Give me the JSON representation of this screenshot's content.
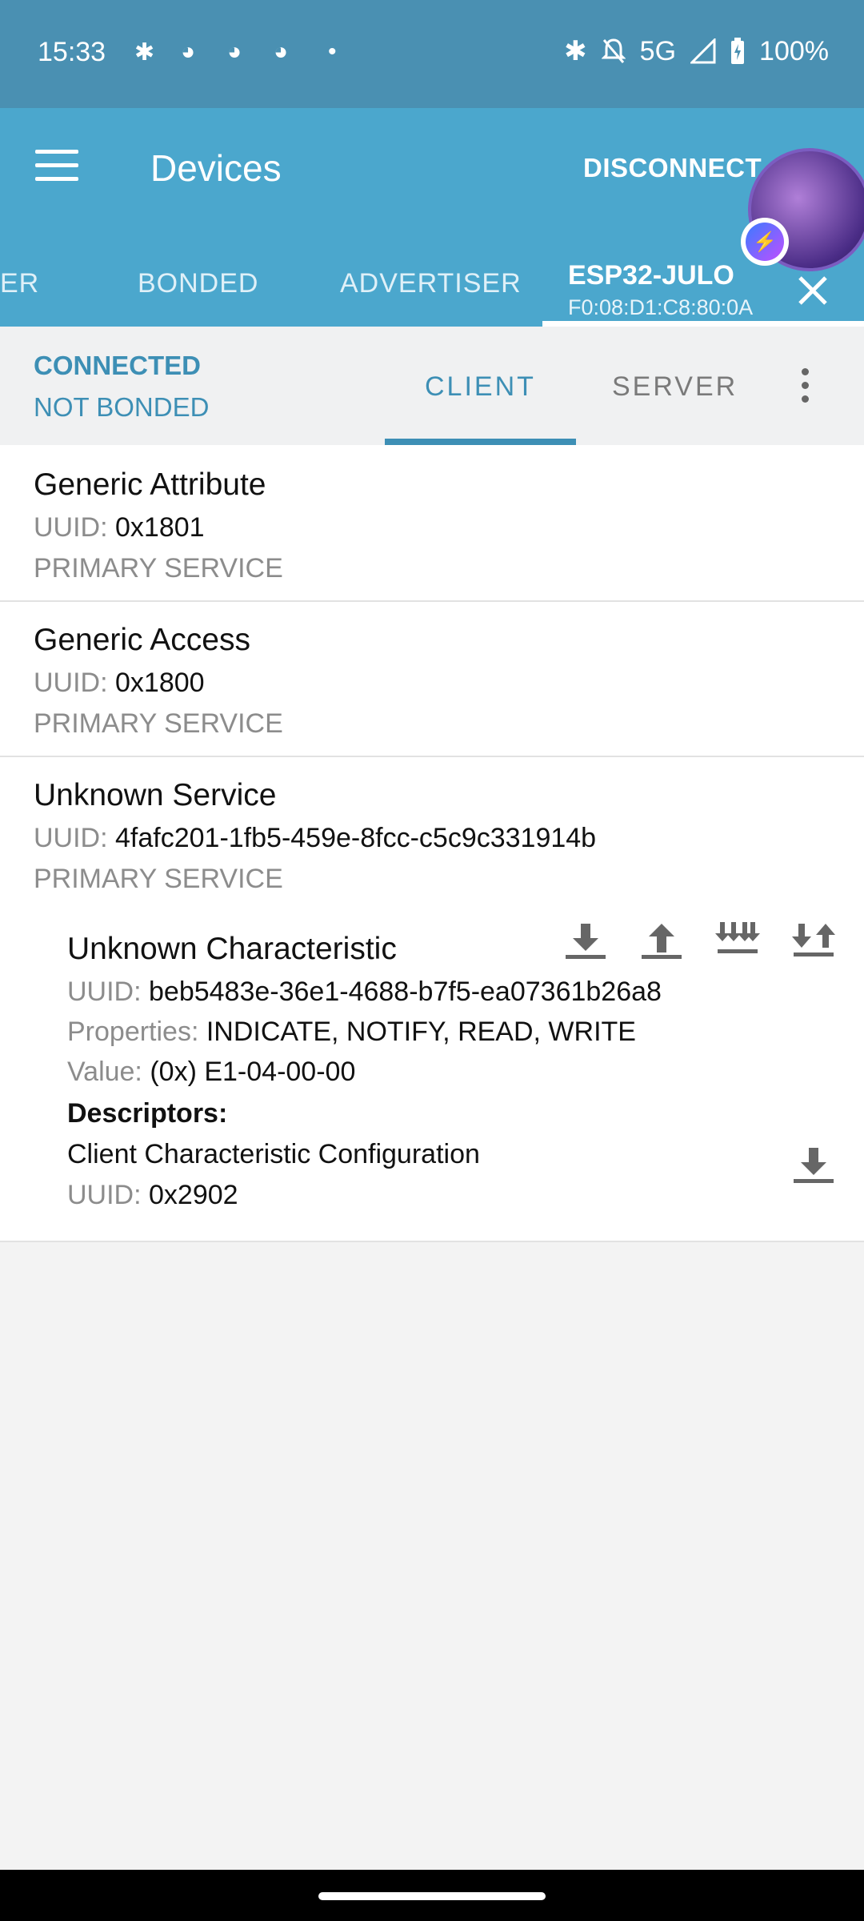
{
  "status_bar": {
    "time": "15:33",
    "network": "5G",
    "battery": "100%",
    "notification_icons": [
      "slack-icon",
      "discord-icon",
      "discord-icon",
      "discord-icon",
      "dot-icon"
    ],
    "system_icons": [
      "bluetooth-icon",
      "bell-off-icon",
      "signal-icon",
      "battery-charging-icon"
    ]
  },
  "app_bar": {
    "title": "Devices",
    "disconnect_label": "DISCONNECT",
    "tabs": [
      {
        "label": "ER"
      },
      {
        "label": "BONDED"
      },
      {
        "label": "ADVERTISER"
      }
    ],
    "active_tab": {
      "name": "ESP32-JULO",
      "mac": "F0:08:D1:C8:80:0A"
    }
  },
  "connection": {
    "status": "CONNECTED",
    "bond": "NOT BONDED",
    "client_tab": "CLIENT",
    "server_tab": "SERVER"
  },
  "labels": {
    "uuid": "UUID:",
    "properties": "Properties:",
    "value": "Value:",
    "descriptors": "Descriptors:"
  },
  "services": [
    {
      "name": "Generic Attribute",
      "uuid": "0x1801",
      "type": "PRIMARY SERVICE"
    },
    {
      "name": "Generic Access",
      "uuid": "0x1800",
      "type": "PRIMARY SERVICE"
    },
    {
      "name": "Unknown Service",
      "uuid": "4fafc201-1fb5-459e-8fcc-c5c9c331914b",
      "type": "PRIMARY SERVICE"
    }
  ],
  "characteristic": {
    "name": "Unknown Characteristic",
    "uuid": "beb5483e-36e1-4688-b7f5-ea07361b26a8",
    "properties": "INDICATE, NOTIFY, READ, WRITE",
    "value": "(0x) E1-04-00-00",
    "actions": [
      "download-icon",
      "upload-icon",
      "multiple-download-icon",
      "download-upload-icon"
    ]
  },
  "descriptor": {
    "name": "Client Characteristic Configuration",
    "uuid": "0x2902"
  },
  "colors": {
    "status_bar": "#4a90b2",
    "app_bar": "#4ba7cd",
    "accent": "#3d8fb5"
  }
}
